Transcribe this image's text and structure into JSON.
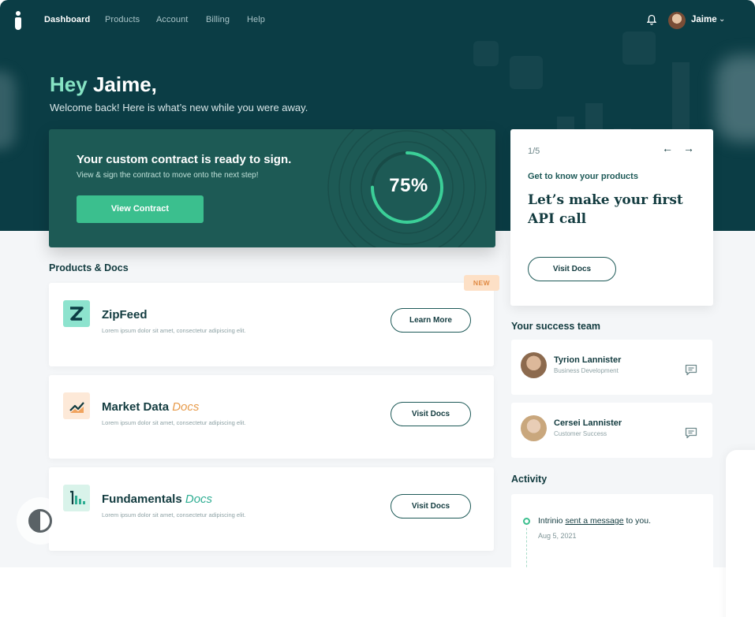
{
  "nav": {
    "items": [
      "Dashboard",
      "Products",
      "Account",
      "Billing",
      "Help"
    ],
    "user_name": "Jaime"
  },
  "hero": {
    "greeting_hey": "Hey",
    "greeting_name": "Jaime,",
    "welcome": "Welcome back!  Here is what’s new while you were away."
  },
  "contract": {
    "title": "Your custom contract is ready to sign.",
    "subtitle": "View & sign the contract to move onto the next step!",
    "button": "View Contract",
    "progress_label": "75%",
    "progress_value": 0.75
  },
  "carousel": {
    "counter": "1/5",
    "kicker": "Get to know your products",
    "heading": "Let’s make your first API call",
    "button": "Visit Docs"
  },
  "products": {
    "section_title": "Products & Docs",
    "badge": "NEW",
    "items": [
      {
        "name": "ZipFeed",
        "suffix": "",
        "description": "Lorem ipsum dolor sit amet, consectetur adipiscing elit.",
        "button": "Learn More",
        "icon": "zipfeed-logo-icon"
      },
      {
        "name": "Market Data",
        "suffix": "Docs",
        "description": "Lorem ipsum dolor sit amet, consectetur adipiscing elit.",
        "button": "Visit Docs",
        "icon": "line-chart-icon"
      },
      {
        "name": "Fundamentals",
        "suffix": "Docs",
        "description": "Lorem ipsum dolor sit amet, consectetur adipiscing elit.",
        "button": "Visit Docs",
        "icon": "bar-chart-icon"
      }
    ]
  },
  "team": {
    "section_title": "Your success team",
    "members": [
      {
        "name": "Tyrion Lannister",
        "role": "Business Development"
      },
      {
        "name": "Cersei Lannister",
        "role": "Customer Success"
      }
    ]
  },
  "activity": {
    "section_title": "Activity",
    "entries": [
      {
        "actor": "Intrinio",
        "link": "sent a message",
        "rest": "to you.",
        "date": "Aug 5, 2021"
      }
    ]
  },
  "colors": {
    "hero_bg": "#0b3d45",
    "accent_green": "#3bbf8e",
    "mint": "#86e3c3",
    "docs_orange": "#e79b4b",
    "docs_teal": "#2fae93"
  }
}
